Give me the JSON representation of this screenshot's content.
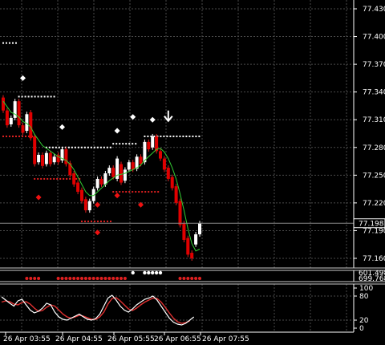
{
  "chart_data": [
    {
      "type": "candlestick",
      "title": "",
      "price_axis_labels": [
        "77.430",
        "77.400",
        "77.370",
        "77.340",
        "77.310",
        "77.280",
        "77.250",
        "77.220",
        "77.190",
        "77.160"
      ],
      "current_price_label": "77.198",
      "time_labels": [
        "26 Apr 03:55",
        "26 Apr 04:55",
        "26 Apr 05:55",
        "26 Apr 06:55",
        "26 Apr 07:55"
      ],
      "ylim": [
        77.15,
        77.445
      ],
      "grid": true,
      "candles": [
        {
          "o": 77.334,
          "c": 77.32,
          "dir": "down"
        },
        {
          "o": 77.32,
          "c": 77.304,
          "dir": "down"
        },
        {
          "o": 77.305,
          "c": 77.312,
          "dir": "up"
        },
        {
          "o": 77.312,
          "c": 77.33,
          "dir": "up"
        },
        {
          "o": 77.33,
          "c": 77.304,
          "dir": "down"
        },
        {
          "o": 77.304,
          "c": 77.296,
          "dir": "down"
        },
        {
          "o": 77.298,
          "c": 77.316,
          "dir": "up"
        },
        {
          "o": 77.318,
          "c": 77.29,
          "dir": "down"
        },
        {
          "o": 77.292,
          "c": 77.262,
          "dir": "down"
        },
        {
          "o": 77.264,
          "c": 77.272,
          "dir": "up"
        },
        {
          "o": 77.272,
          "c": 77.26,
          "dir": "down"
        },
        {
          "o": 77.262,
          "c": 77.274,
          "dir": "up"
        },
        {
          "o": 77.274,
          "c": 77.262,
          "dir": "down"
        },
        {
          "o": 77.264,
          "c": 77.27,
          "dir": "up"
        },
        {
          "o": 77.272,
          "c": 77.264,
          "dir": "down"
        },
        {
          "o": 77.266,
          "c": 77.278,
          "dir": "up"
        },
        {
          "o": 77.278,
          "c": 77.262,
          "dir": "down"
        },
        {
          "o": 77.263,
          "c": 77.25,
          "dir": "down"
        },
        {
          "o": 77.252,
          "c": 77.24,
          "dir": "down"
        },
        {
          "o": 77.242,
          "c": 77.232,
          "dir": "down"
        },
        {
          "o": 77.234,
          "c": 77.222,
          "dir": "down"
        },
        {
          "o": 77.224,
          "c": 77.212,
          "dir": "down"
        },
        {
          "o": 77.212,
          "c": 77.222,
          "dir": "up"
        },
        {
          "o": 77.222,
          "c": 77.235,
          "dir": "up"
        },
        {
          "o": 77.236,
          "c": 77.246,
          "dir": "up"
        },
        {
          "o": 77.246,
          "c": 77.24,
          "dir": "down"
        },
        {
          "o": 77.24,
          "c": 77.252,
          "dir": "up"
        },
        {
          "o": 77.252,
          "c": 77.258,
          "dir": "up"
        },
        {
          "o": 77.258,
          "c": 77.248,
          "dir": "down"
        },
        {
          "o": 77.246,
          "c": 77.268,
          "dir": "up"
        },
        {
          "o": 77.262,
          "c": 77.242,
          "dir": "down"
        },
        {
          "o": 77.244,
          "c": 77.256,
          "dir": "up"
        },
        {
          "o": 77.256,
          "c": 77.264,
          "dir": "up"
        },
        {
          "o": 77.264,
          "c": 77.256,
          "dir": "down"
        },
        {
          "o": 77.257,
          "c": 77.27,
          "dir": "up"
        },
        {
          "o": 77.27,
          "c": 77.262,
          "dir": "down"
        },
        {
          "o": 77.264,
          "c": 77.286,
          "dir": "up"
        },
        {
          "o": 77.286,
          "c": 77.278,
          "dir": "down"
        },
        {
          "o": 77.28,
          "c": 77.292,
          "dir": "up"
        },
        {
          "o": 77.292,
          "c": 77.276,
          "dir": "down"
        },
        {
          "o": 77.276,
          "c": 77.268,
          "dir": "down"
        },
        {
          "o": 77.268,
          "c": 77.256,
          "dir": "down"
        },
        {
          "o": 77.258,
          "c": 77.246,
          "dir": "down"
        },
        {
          "o": 77.248,
          "c": 77.236,
          "dir": "down"
        },
        {
          "o": 77.238,
          "c": 77.22,
          "dir": "down"
        },
        {
          "o": 77.222,
          "c": 77.196,
          "dir": "down"
        },
        {
          "o": 77.198,
          "c": 77.18,
          "dir": "down"
        },
        {
          "o": 77.182,
          "c": 77.164,
          "dir": "down"
        },
        {
          "o": 77.166,
          "c": 77.16,
          "dir": "down"
        },
        {
          "o": 77.175,
          "c": 77.186,
          "dir": "up"
        },
        {
          "o": 77.186,
          "c": 77.198,
          "dir": "up"
        }
      ],
      "ma_values": [
        77.33,
        77.324,
        77.318,
        77.316,
        77.313,
        77.308,
        77.306,
        77.302,
        77.294,
        77.288,
        77.282,
        77.279,
        77.276,
        77.273,
        77.27,
        77.268,
        77.266,
        77.262,
        77.256,
        77.248,
        77.24,
        77.232,
        77.228,
        77.228,
        77.232,
        77.236,
        77.24,
        77.244,
        77.247,
        77.25,
        77.251,
        77.252,
        77.254,
        77.256,
        77.258,
        77.261,
        77.266,
        77.27,
        77.274,
        77.278,
        77.279,
        77.275,
        77.268,
        77.258,
        77.246,
        77.23,
        77.212,
        77.192,
        77.176,
        77.168,
        77.17
      ],
      "resistance_dots": [
        {
          "price": 77.393,
          "from": 0,
          "to": 4
        },
        {
          "price": 77.335,
          "from": 4,
          "to": 13
        },
        {
          "price": 77.28,
          "from": 11,
          "to": 28
        },
        {
          "price": 77.284,
          "from": 28,
          "to": 34
        },
        {
          "price": 77.292,
          "from": 36,
          "to": 50
        }
      ],
      "support_dots": [
        {
          "price": 77.292,
          "from": 0,
          "to": 8
        },
        {
          "price": 77.246,
          "from": 8,
          "to": 20
        },
        {
          "price": 77.2,
          "from": 20,
          "to": 28
        },
        {
          "price": 77.232,
          "from": 28,
          "to": 40
        }
      ],
      "white_diamonds": [
        {
          "i": 5,
          "price": 77.355
        },
        {
          "i": 15,
          "price": 77.302
        },
        {
          "i": 29,
          "price": 77.298
        },
        {
          "i": 33,
          "price": 77.313
        },
        {
          "i": 38,
          "price": 77.31
        }
      ],
      "red_diamonds": [
        {
          "i": 9,
          "price": 77.226
        },
        {
          "i": 24,
          "price": 77.218
        },
        {
          "i": 29,
          "price": 77.228
        },
        {
          "i": 35,
          "price": 77.218
        },
        {
          "i": 24,
          "price": 77.188
        }
      ],
      "arrows": [
        {
          "i": 42,
          "price": 77.313,
          "direction": "down"
        }
      ],
      "indicator_a_labels": [
        "601.4987",
        "699.7686"
      ],
      "indicator_a_red_dots_idx": [
        6,
        7,
        8,
        9,
        14,
        15,
        16,
        17,
        18,
        19,
        20,
        21,
        22,
        23,
        24,
        25,
        26,
        27,
        28,
        29,
        30,
        31,
        45,
        46,
        47,
        48,
        49,
        50
      ],
      "indicator_a_white_dots_idx": [
        33,
        36,
        37,
        38,
        39,
        40
      ],
      "oscillator": {
        "levels": [
          "100",
          "80",
          "20",
          "0"
        ],
        "main": [
          78,
          70,
          62,
          55,
          68,
          72,
          58,
          45,
          38,
          42,
          50,
          62,
          58,
          40,
          28,
          22,
          20,
          25,
          30,
          35,
          28,
          22,
          20,
          24,
          35,
          55,
          75,
          82,
          70,
          55,
          45,
          40,
          48,
          58,
          65,
          72,
          75,
          80,
          70,
          55,
          40,
          25,
          15,
          10,
          8,
          12,
          20,
          28
        ],
        "signal": [
          65,
          68,
          66,
          60,
          58,
          64,
          66,
          60,
          50,
          42,
          44,
          52,
          58,
          55,
          45,
          35,
          28,
          25,
          28,
          32,
          30,
          26,
          22,
          22,
          28,
          40,
          60,
          74,
          76,
          68,
          58,
          48,
          44,
          50,
          58,
          65,
          70,
          75,
          74,
          65,
          52,
          38,
          25,
          16,
          12,
          14,
          18
        ]
      }
    }
  ]
}
